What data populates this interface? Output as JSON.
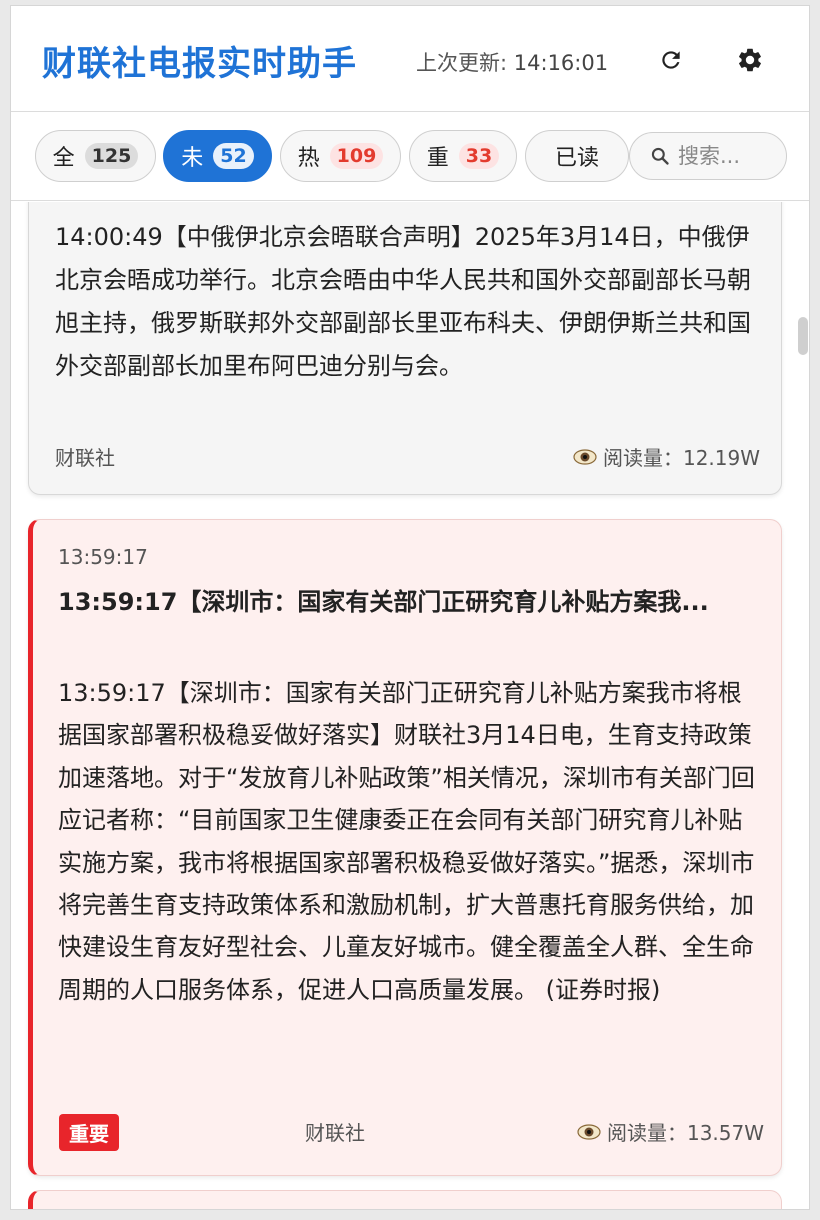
{
  "header": {
    "title": "财联社电报实时助手",
    "update_label": "上次更新:",
    "update_time": "14:16:01",
    "refresh_icon": "refresh-icon",
    "settings_icon": "gear-icon",
    "accent_color": "#1f73d6"
  },
  "filters": [
    {
      "label": "全",
      "count": "125"
    },
    {
      "label": "未",
      "count": "52"
    },
    {
      "label": "热",
      "count": "109"
    },
    {
      "label": "重",
      "count": "33"
    },
    {
      "label": "已读"
    }
  ],
  "search": {
    "placeholder": "搜索..."
  },
  "cards": [
    {
      "body": "14:00:49【中俄伊北京会晤联合声明】2025年3月14日，中俄伊北京会晤成功举行。北京会晤由中华人民共和国外交部副部长马朝旭主持，俄罗斯联邦外交部副部长里亚布科夫、伊朗伊斯兰共和国外交部副部长加里布阿巴迪分别与会。",
      "source": "财联社",
      "reads": "阅读量：12.19W"
    },
    {
      "time": "13:59:17",
      "title": "13:59:17【深圳市：国家有关部门正研究育儿补贴方案我...",
      "body": "13:59:17【深圳市：国家有关部门正研究育儿补贴方案我市将根据国家部署积极稳妥做好落实】财联社3月14日电，生育支持政策加速落地。对于“发放育儿补贴政策”相关情况，深圳市有关部门回应记者称：“目前国家卫生健康委正在会同有关部门研究育儿补贴实施方案，我市将根据国家部署积极稳妥做好落实。”据悉，深圳市将完善生育支持政策体系和激励机制，扩大普惠托育服务供给，加快建设生育友好型社会、儿童友好城市。健全覆盖全人群、全生命周期的人口服务体系，促进人口高质量发展。 (证券时报)",
      "badge": "重要",
      "source": "财联社",
      "reads": "阅读量：13.57W",
      "highlight_color": "#e8252b"
    }
  ]
}
